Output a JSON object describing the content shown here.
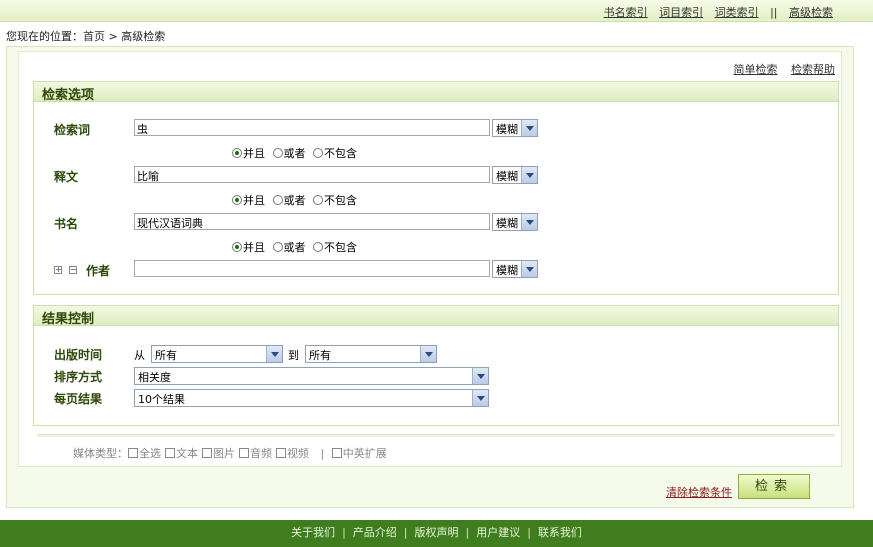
{
  "topnav": {
    "book_index": "书名索引",
    "entry_index": "词目索引",
    "category_index": "词类索引",
    "separator": "||",
    "advanced_search": "高级检索"
  },
  "breadcrumb": {
    "prefix": "您现在的位置：",
    "home": "首页",
    "arrow": ">",
    "current": "高级检索"
  },
  "help": {
    "simple_search": "简单检索",
    "search_help": "检索帮助"
  },
  "search_options": {
    "title": "检索选项",
    "fields": [
      {
        "label": "检索词",
        "value": "虫",
        "match": "模糊"
      },
      {
        "label": "释文",
        "value": "比喻",
        "match": "模糊"
      },
      {
        "label": "书名",
        "value": "现代汉语词典",
        "match": "模糊"
      },
      {
        "label": "作者",
        "value": "",
        "match": "模糊"
      }
    ],
    "operators": [
      "并且",
      "或者",
      "不包含"
    ],
    "selected_operator": "并且",
    "expand_icon": "plus-box-icon",
    "collapse_icon": "minus-box-icon"
  },
  "result_control": {
    "title": "结果控制",
    "pub_time_label": "出版时间",
    "from_label": "从",
    "from_value": "所有",
    "to_label": "到",
    "to_value": "所有",
    "sort_label": "排序方式",
    "sort_value": "相关度",
    "per_page_label": "每页结果",
    "per_page_value": "10个结果"
  },
  "media": {
    "label": "媒体类型：",
    "options": [
      "全选",
      "文本",
      "图片",
      "音频",
      "视频"
    ],
    "divider": "|",
    "extra": "中英扩展"
  },
  "actions": {
    "clear": "清除检索条件",
    "search": "检索"
  },
  "footer": {
    "links": [
      "关于我们",
      "产品介绍",
      "版权声明",
      "用户建议",
      "联系我们"
    ],
    "separator": "|"
  },
  "colors": {
    "footer_bg": "#3f7d1f",
    "accent_green": "#2d4a0a",
    "panel_border": "#d0e0aa"
  }
}
